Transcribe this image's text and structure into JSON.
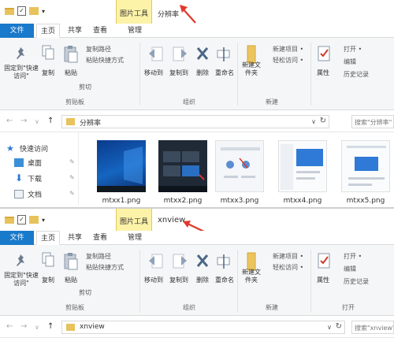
{
  "top_window": {
    "context_tab": "图片工具",
    "title": "分辨率",
    "tabs": {
      "file": "文件",
      "home": "主页",
      "share": "共享",
      "view": "查看",
      "manage": "管理"
    },
    "ribbon": {
      "pin_quick_access": "固定到\"快速访问\"",
      "copy": "复制",
      "paste": "粘贴",
      "copy_path": "复制路径",
      "paste_shortcut": "粘贴快捷方式",
      "cut": "剪切",
      "move_to": "移动到",
      "copy_to": "复制到",
      "delete": "删除",
      "rename": "重命名",
      "new_folder": "新建文件夹",
      "new_item": "新建项目 •",
      "easy_access": "轻松访问 •",
      "properties": "属性",
      "open": "打开 •",
      "edit": "编辑",
      "history": "历史记录",
      "group_clipboard": "剪贴板",
      "group_organize": "组织",
      "group_new": "新建"
    },
    "address_path": "分辨率",
    "search_placeholder": "搜索\"分辨率\"",
    "nav_items": [
      {
        "label": "快速访问"
      },
      {
        "label": "桌面"
      },
      {
        "label": "下载"
      },
      {
        "label": "文档"
      }
    ],
    "files": [
      "mtxx1.png",
      "mtxx2.png",
      "mtxx3.png",
      "mtxx4.png",
      "mtxx5.png"
    ]
  },
  "bottom_window": {
    "context_tab": "图片工具",
    "title": "xnview",
    "tabs": {
      "file": "文件",
      "home": "主页",
      "share": "共享",
      "view": "查看",
      "manage": "管理"
    },
    "ribbon": {
      "pin_quick_access": "固定到\"快速访问\"",
      "copy": "复制",
      "paste": "粘贴",
      "copy_path": "复制路径",
      "paste_shortcut": "粘贴快捷方式",
      "cut": "剪切",
      "move_to": "移动到",
      "copy_to": "复制到",
      "delete": "删除",
      "rename": "重命名",
      "new_folder": "新建文件夹",
      "new_item": "新建项目 •",
      "easy_access": "轻松访问 •",
      "properties": "属性",
      "open": "打开 •",
      "edit": "编辑",
      "history": "历史记录",
      "group_clipboard": "剪贴板",
      "group_organize": "组织",
      "group_new": "新建",
      "group_open": "打开"
    },
    "address_path": "xnview",
    "search_placeholder": "搜索\"xnview\""
  },
  "colors": {
    "file_tab": "#1979ca",
    "context_tab": "#fcf3a8",
    "annotation_arrow": "#e0382b"
  }
}
